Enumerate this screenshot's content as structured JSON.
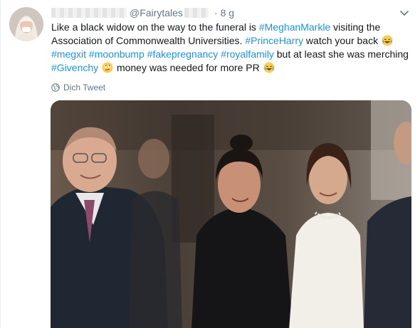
{
  "tweet": {
    "handle": "@Fairytales",
    "timestamp": "8 g",
    "separator": "·",
    "text": {
      "l1_a": "Like a black widow on the way to the funeral is ",
      "l1_tag": "#MeghanMarkle",
      "l1_b": " visiting the",
      "l2_a": "Association of Commonwealth Universities. ",
      "l2_tag": "#PrinceHarry",
      "l2_b": " watch your back",
      "l3_tag1": "#megxit",
      "l3_tag2": "#moonbump",
      "l3_tag3": "#fakepregnancy",
      "l3_tag4": "#royalfamily",
      "l3_b": " but at least she was merching",
      "l4_tag": "#Givenchy",
      "l4_b": " money was needed for more PR"
    },
    "translate_label": "Dịch Tweet",
    "icons": {
      "menu": "chevron-down-icon",
      "translate": "globe-icon",
      "emoji_laugh": "face-with-tears-of-joy",
      "emoji_eyeroll": "face-with-rolling-eyes"
    },
    "colors": {
      "link": "#1b95e0",
      "text": "#14171a",
      "muted": "#657786"
    }
  }
}
